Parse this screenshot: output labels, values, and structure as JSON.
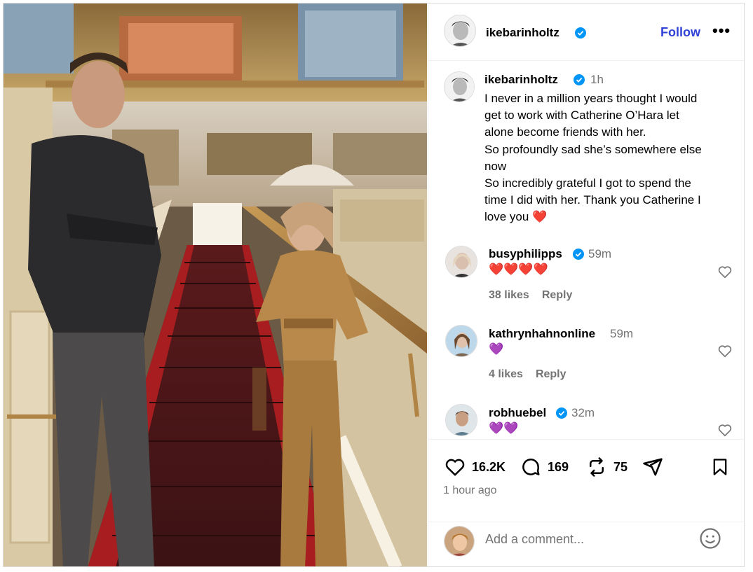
{
  "author": {
    "username": "ikebarinholtz",
    "verified": true,
    "follow_label": "Follow",
    "more_label": "•••"
  },
  "caption": {
    "username": "ikebarinholtz",
    "time": "1h",
    "lines": [
      "I never in a million years thought I would",
      "get to work with Catherine O’Hara let",
      "alone become friends with her.",
      "So profoundly sad she’s somewhere else",
      "now",
      "So incredibly grateful I got to spend the",
      "time I did with her. Thank you Catherine I",
      "love you ❤️"
    ]
  },
  "comments": [
    {
      "username": "busyphilipps",
      "verified": true,
      "time": "59m",
      "text": "❤️❤️❤️❤️",
      "likes": "38 likes",
      "reply": "Reply"
    },
    {
      "username": "kathrynhahnonline",
      "verified": false,
      "time": "59m",
      "text": "💜",
      "likes": "4 likes",
      "reply": "Reply"
    },
    {
      "username": "robhuebel",
      "verified": true,
      "time": "32m",
      "text": "💜💜"
    }
  ],
  "actions": {
    "likes": "16.2K",
    "comments": "169",
    "reposts": "75",
    "posted": "1 hour ago"
  },
  "add_comment": {
    "placeholder": "Add a comment..."
  },
  "colors": {
    "accent": "#3143d6",
    "verified": "#0095f6",
    "muted": "#737373"
  },
  "icons": [
    "heart-icon",
    "comment-icon",
    "repost-icon",
    "share-icon",
    "bookmark-icon",
    "verified-badge-icon",
    "smile-icon",
    "more-icon"
  ]
}
